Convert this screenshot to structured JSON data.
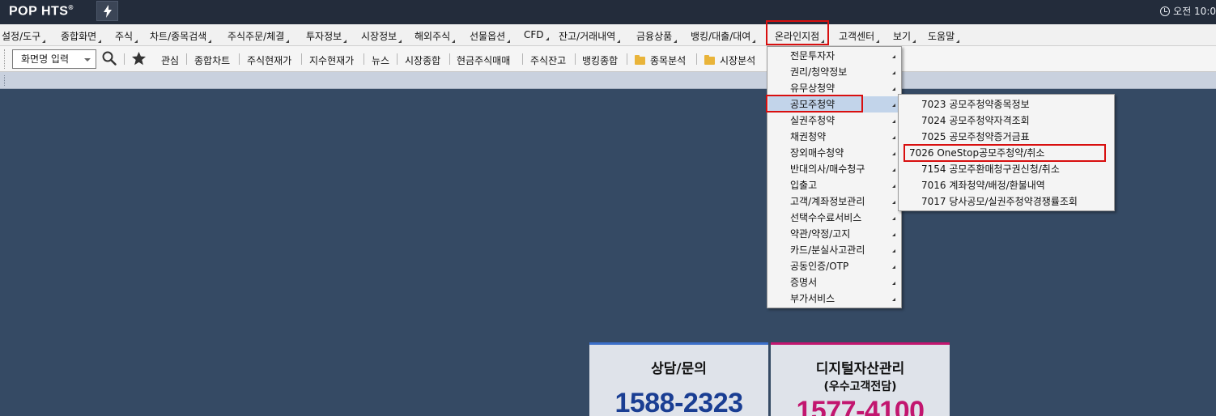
{
  "app": {
    "logo_text": "POP HTS",
    "clock_text": "오전 10:0"
  },
  "menu": [
    {
      "label": "설정/도구"
    },
    {
      "label": "종합화면"
    },
    {
      "label": "주식"
    },
    {
      "label": "차트/종목검색"
    },
    {
      "label": "주식주문/체결"
    },
    {
      "label": "투자정보"
    },
    {
      "label": "시장정보"
    },
    {
      "label": "해외주식"
    },
    {
      "label": "선물옵션"
    },
    {
      "label": "CFD"
    },
    {
      "label": "잔고/거래내역"
    },
    {
      "label": "금융상품"
    },
    {
      "label": "뱅킹/대출/대여"
    },
    {
      "label": "온라인지점"
    },
    {
      "label": "고객센터"
    },
    {
      "label": "보기"
    },
    {
      "label": "도움말"
    }
  ],
  "toolbar": {
    "screen_name_placeholder": "화면명 입력",
    "items": [
      {
        "label": "관심"
      },
      {
        "label": "종합차트"
      },
      {
        "label": "주식현재가"
      },
      {
        "label": "지수현재가"
      },
      {
        "label": "뉴스"
      },
      {
        "label": "시장종합"
      },
      {
        "label": "현금주식매매"
      },
      {
        "label": "주식잔고"
      },
      {
        "label": "뱅킹종합"
      },
      {
        "label": "종목분석"
      },
      {
        "label": "시장분석"
      }
    ]
  },
  "online_branch_menu": [
    {
      "label": "전문투자자"
    },
    {
      "label": "권리/청약정보"
    },
    {
      "label": "유무상청약"
    },
    {
      "label": "공모주청약"
    },
    {
      "label": "실권주청약"
    },
    {
      "label": "채권청약"
    },
    {
      "label": "장외매수청약"
    },
    {
      "label": "반대의사/매수청구"
    },
    {
      "label": "입출고"
    },
    {
      "label": "고객/계좌정보관리"
    },
    {
      "label": "선택수수료서비스"
    },
    {
      "label": "약관/약정/고지"
    },
    {
      "label": "카드/분실사고관리"
    },
    {
      "label": "공동인증/OTP"
    },
    {
      "label": "증명서"
    },
    {
      "label": "부가서비스"
    }
  ],
  "ipo_submenu": [
    {
      "label": "7023 공모주청약종목정보"
    },
    {
      "label": "7024 공모주청약자격조회"
    },
    {
      "label": "7025 공모주청약증거금표"
    },
    {
      "label": "7026 OneStop공모주청약/취소"
    },
    {
      "label": "7154 공모주환매청구권신청/취소"
    },
    {
      "label": "7016 계좌청약/배정/환불내역"
    },
    {
      "label": "7017 당사공모/실권주청약경쟁률조회"
    }
  ],
  "contacts": [
    {
      "title": "상담/문의",
      "subtitle": "",
      "phone": "1588-2323",
      "color": "#1a3e93"
    },
    {
      "title": "디지털자산관리",
      "subtitle": "(우수고객전담)",
      "phone": "1577-4100",
      "color": "#c2166f"
    }
  ]
}
